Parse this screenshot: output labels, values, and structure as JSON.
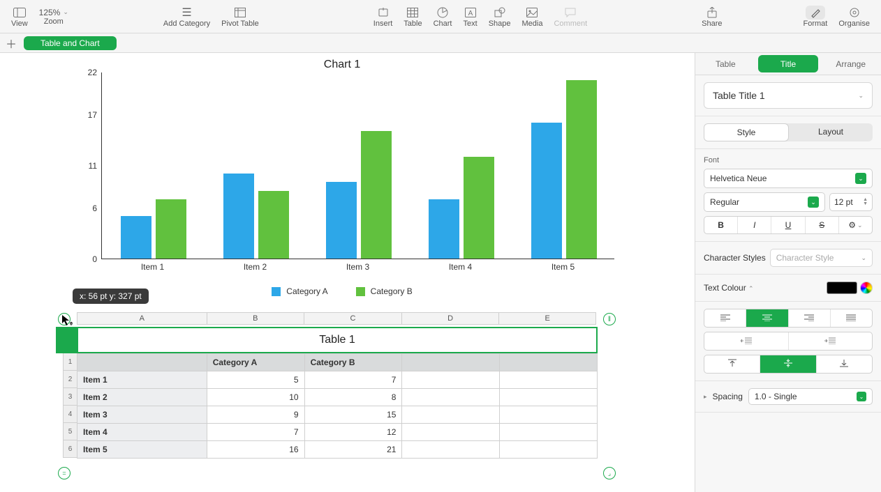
{
  "toolbar": {
    "view": "View",
    "zoom_label": "Zoom",
    "zoom_value": "125%",
    "add_category": "Add Category",
    "pivot_table": "Pivot Table",
    "insert": "Insert",
    "table": "Table",
    "chart": "Chart",
    "text": "Text",
    "shape": "Shape",
    "media": "Media",
    "comment": "Comment",
    "share": "Share",
    "format": "Format",
    "organise": "Organise"
  },
  "sheet_tab": "Table and Chart",
  "chart_data": {
    "type": "bar",
    "title": "Chart 1",
    "categories": [
      "Item 1",
      "Item 2",
      "Item 3",
      "Item 4",
      "Item 5"
    ],
    "series": [
      {
        "name": "Category A",
        "values": [
          5,
          10,
          9,
          7,
          16
        ],
        "color": "#2da7e8"
      },
      {
        "name": "Category B",
        "values": [
          7,
          8,
          15,
          12,
          21
        ],
        "color": "#61c13e"
      }
    ],
    "yticks": [
      0,
      6,
      11,
      17,
      22
    ],
    "ylim": [
      0,
      22
    ]
  },
  "tooltip": "x: 56 pt  y: 327 pt",
  "col_ruler": [
    "A",
    "B",
    "C",
    "D",
    "E"
  ],
  "table": {
    "title": "Table 1",
    "headers": [
      "",
      "Category A",
      "Category B"
    ],
    "rows": [
      {
        "n": "1"
      },
      {
        "n": "2",
        "item": "Item 1",
        "a": "5",
        "b": "7"
      },
      {
        "n": "3",
        "item": "Item 2",
        "a": "10",
        "b": "8"
      },
      {
        "n": "4",
        "item": "Item 3",
        "a": "9",
        "b": "15"
      },
      {
        "n": "5",
        "item": "Item 4",
        "a": "7",
        "b": "12"
      },
      {
        "n": "6",
        "item": "Item 5",
        "a": "16",
        "b": "21"
      }
    ]
  },
  "inspector": {
    "tabs": {
      "table": "Table",
      "title": "Title",
      "arrange": "Arrange"
    },
    "preset": "Table Title 1",
    "seg_style": "Style",
    "seg_layout": "Layout",
    "font_label": "Font",
    "font_family": "Helvetica Neue",
    "font_style": "Regular",
    "font_size": "12 pt",
    "char_styles_label": "Character Styles",
    "char_styles_ph": "Character Style",
    "text_colour_label": "Text Colour",
    "spacing_label": "Spacing",
    "spacing_value": "1.0 - Single"
  }
}
